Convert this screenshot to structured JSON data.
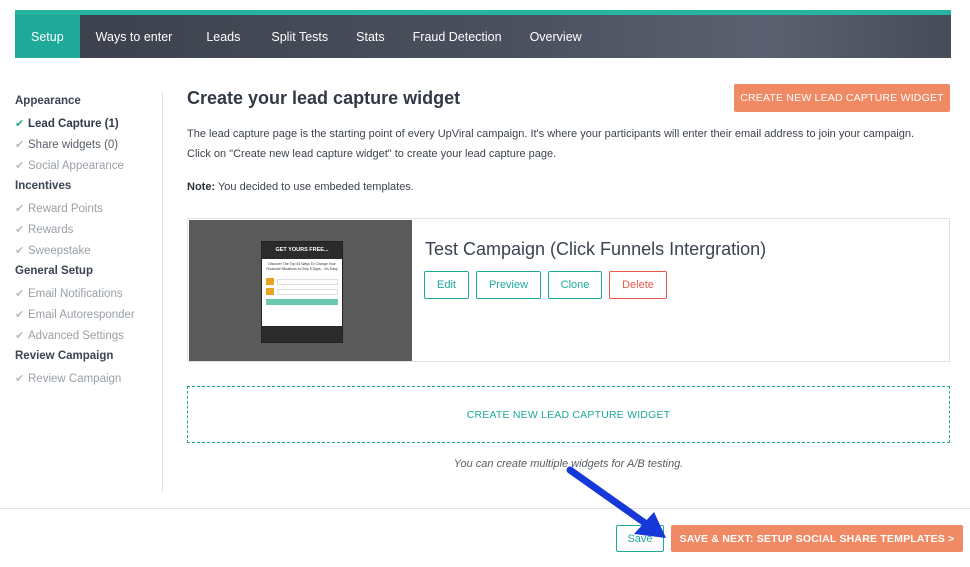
{
  "nav": {
    "tabs": [
      {
        "label": "Setup",
        "active": true
      },
      {
        "label": "Ways to enter",
        "active": false
      },
      {
        "label": "Leads",
        "active": false
      },
      {
        "label": "Split Tests",
        "active": false
      },
      {
        "label": "Stats",
        "active": false
      },
      {
        "label": "Fraud Detection",
        "active": false
      },
      {
        "label": "Overview",
        "active": false
      }
    ],
    "accent_color": "#1fa99a"
  },
  "sidebar": {
    "groups": [
      {
        "heading": "Appearance",
        "items": [
          "Lead Capture (1)",
          "Share widgets (0)",
          "Social Appearance"
        ]
      },
      {
        "heading": "Incentives",
        "items": [
          "Reward Points",
          "Rewards",
          "Sweepstake"
        ]
      },
      {
        "heading": "General Setup",
        "items": [
          "Email Notifications",
          "Email Autoresponder",
          "Advanced Settings"
        ]
      },
      {
        "heading": "Review Campaign",
        "items": [
          "Review Campaign"
        ]
      }
    ],
    "check_icon": "check-icon"
  },
  "main": {
    "title": "Create your lead capture widget",
    "create_top_label": "CREATE NEW LEAD CAPTURE WIDGET",
    "description": "The lead capture page is the starting point of every UpViral campaign. It's where your participants will enter their email address to join your campaign. Click on \"Create new lead capture widget\" to create your lead capture page.",
    "note_label": "Note:",
    "note_text": " You decided to use embeded templates.",
    "widget": {
      "title": "Test Campaign (Click Funnels Intergration)",
      "thumb_header": "GET YOURS FREE...",
      "thumb_text": "Discover The Top #3 Ways To Change Your Financial Situations In Only 5 Days... It's Easy",
      "actions": {
        "edit": "Edit",
        "preview": "Preview",
        "clone": "Clone",
        "delete": "Delete"
      }
    },
    "create_dashed_label": "CREATE NEW LEAD CAPTURE WIDGET",
    "ab_note": "You can create multiple widgets for A/B testing."
  },
  "footer": {
    "save_label": "Save",
    "next_label": "SAVE & NEXT: SETUP SOCIAL SHARE TEMPLATES >",
    "primary_color": "#ef8a64"
  },
  "annotation": {
    "arrow_color": "#1638d8"
  }
}
